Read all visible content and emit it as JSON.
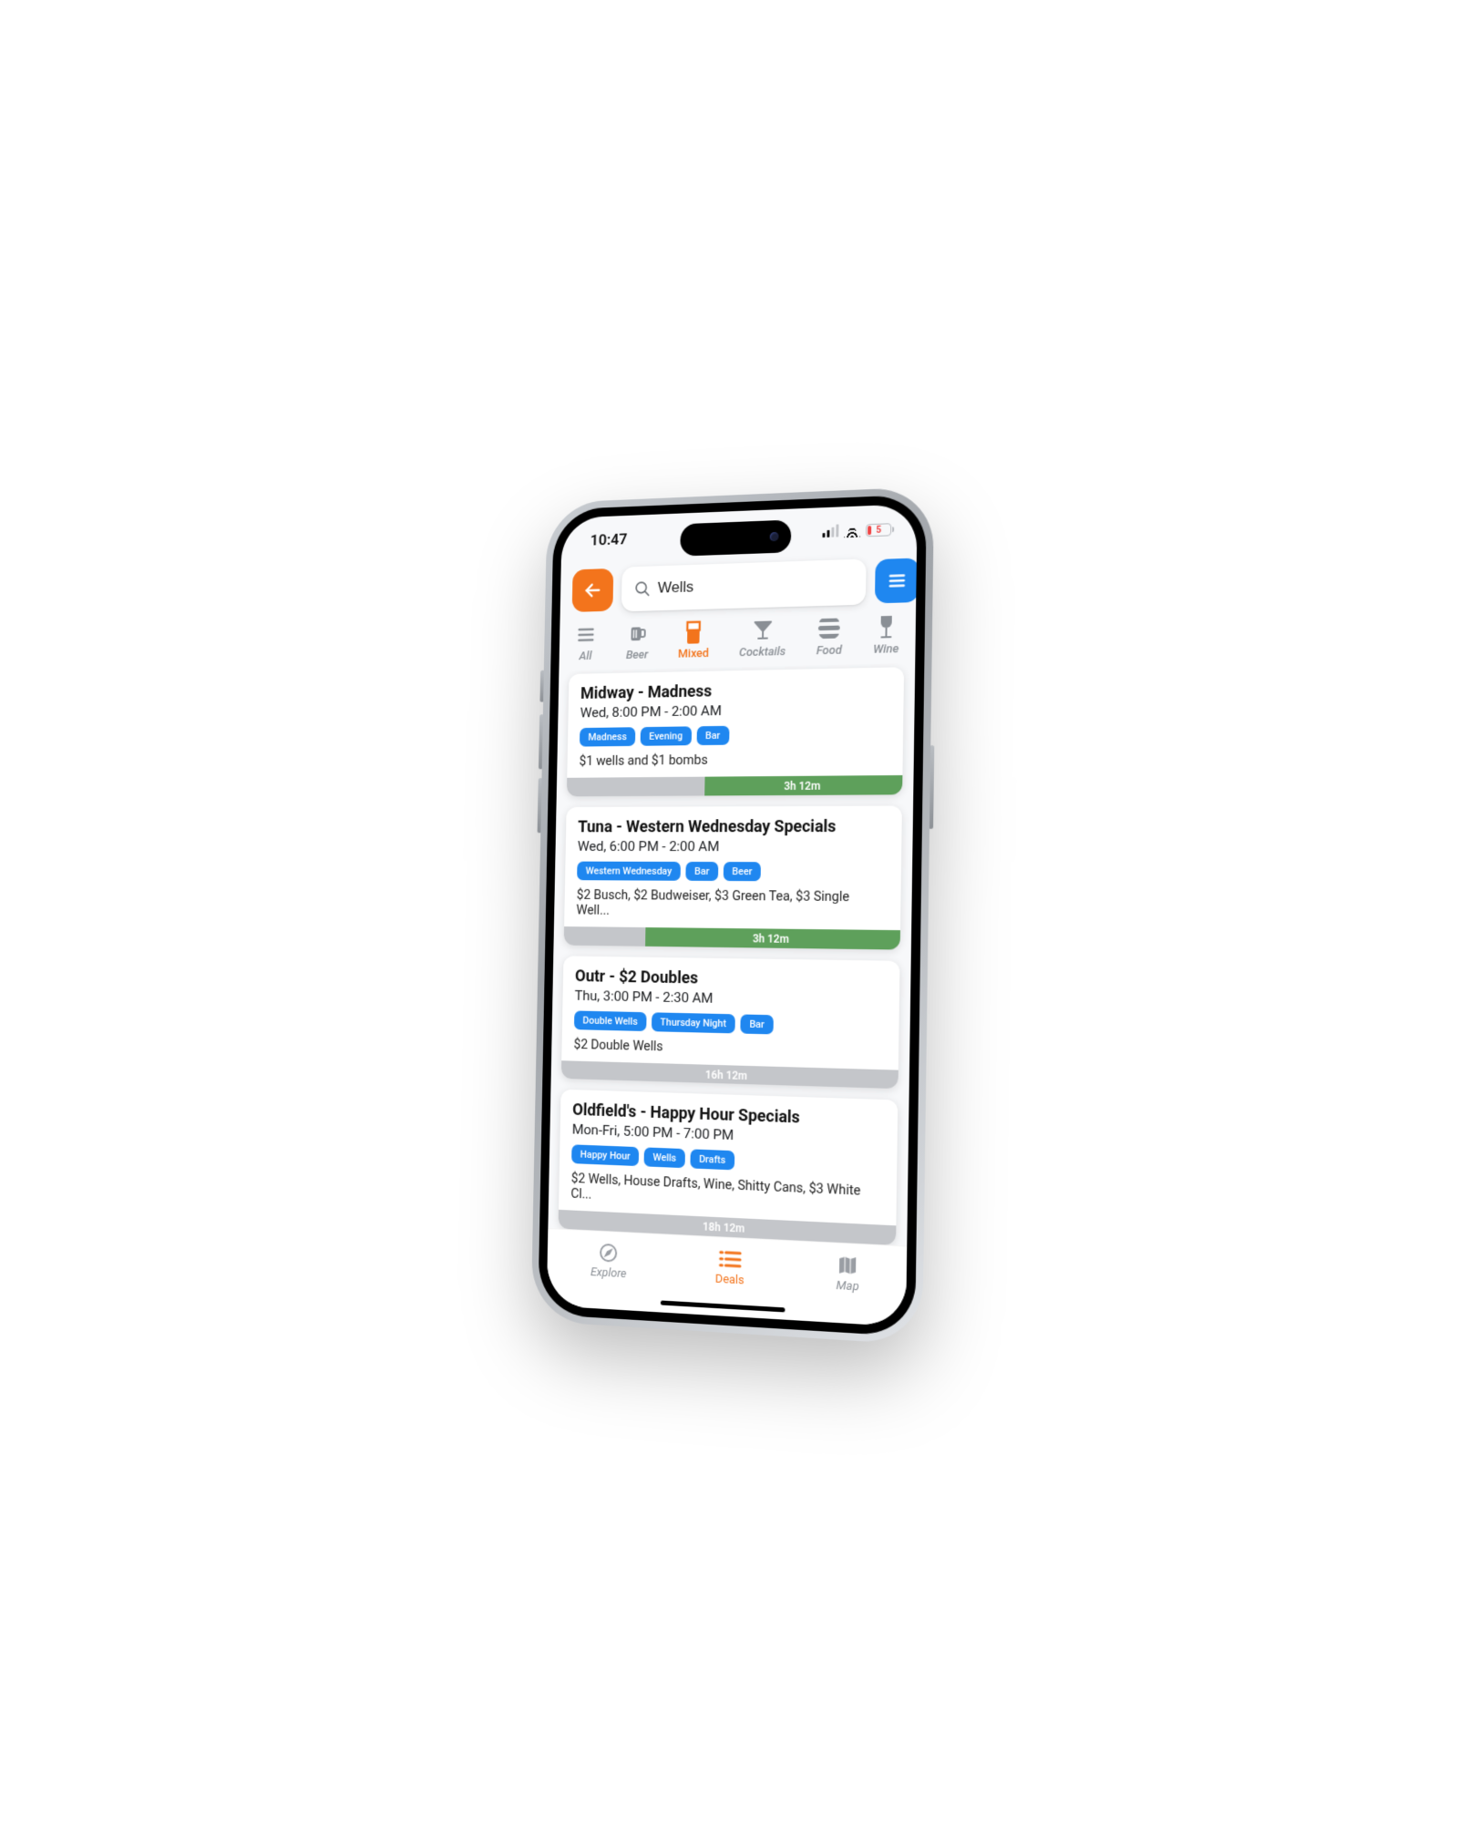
{
  "status": {
    "time": "10:47",
    "battery": "5"
  },
  "search": {
    "value": "Wells"
  },
  "categories": [
    {
      "label": "All",
      "key": "all",
      "active": false
    },
    {
      "label": "Beer",
      "key": "beer",
      "active": false
    },
    {
      "label": "Mixed",
      "key": "mixed",
      "active": true
    },
    {
      "label": "Cocktails",
      "key": "cocktails",
      "active": false
    },
    {
      "label": "Food",
      "key": "food",
      "active": false
    },
    {
      "label": "Wine",
      "key": "wine",
      "active": false
    }
  ],
  "deals": [
    {
      "title": "Midway - Madness",
      "time": "Wed, 8:00 PM - 2:00 AM",
      "tags": [
        "Madness",
        "Evening",
        "Bar"
      ],
      "desc": "$1 wells and $1 bombs",
      "countdown": "3h 12m",
      "pct": 42,
      "active": true
    },
    {
      "title": "Tuna - Western Wednesday Specials",
      "time": "Wed, 6:00 PM - 2:00 AM",
      "tags": [
        "Western Wednesday",
        "Bar",
        "Beer"
      ],
      "desc": "$2 Busch, $2 Budweiser, $3 Green Tea, $3 Single Well...",
      "countdown": "3h 12m",
      "pct": 25,
      "active": true
    },
    {
      "title": "Outr - $2 Doubles",
      "time": "Thu, 3:00 PM - 2:30 AM",
      "tags": [
        "Double Wells",
        "Thursday Night",
        "Bar"
      ],
      "desc": "$2 Double Wells",
      "countdown": "16h 12m",
      "pct": 0,
      "active": false
    },
    {
      "title": "Oldfield's - Happy Hour Specials",
      "time": "Mon-Fri, 5:00 PM - 7:00 PM",
      "tags": [
        "Happy Hour",
        "Wells",
        "Drafts"
      ],
      "desc": "$2 Wells, House Drafts, Wine, Shitty Cans, $3 White Cl...",
      "countdown": "18h 12m",
      "pct": 0,
      "active": false
    }
  ],
  "bottomNav": [
    {
      "label": "Explore",
      "key": "explore",
      "active": false
    },
    {
      "label": "Deals",
      "key": "deals",
      "active": true
    },
    {
      "label": "Map",
      "key": "map",
      "active": false
    }
  ]
}
